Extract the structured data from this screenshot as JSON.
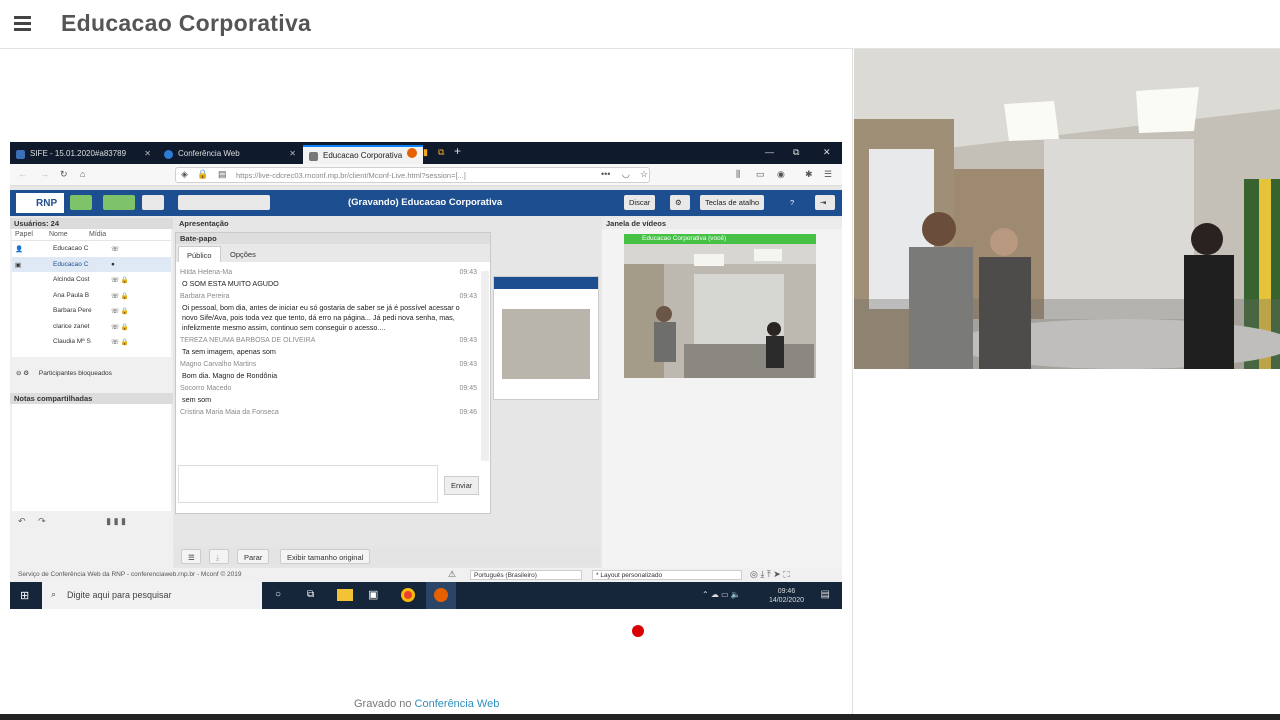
{
  "header": {
    "title": "Educacao Corporativa"
  },
  "footer": {
    "credit_prefix": "Gravado no",
    "credit_link": "Conferência Web"
  },
  "browser": {
    "tabs": [
      {
        "label": "SIFE - 15.01.2020#a83789"
      },
      {
        "label": "Conferência Web"
      },
      {
        "label": "Educacao Corporativa"
      }
    ],
    "url": "https://live-cdcrec03.rnconf.mp.br/client/Mconf-Live.html?session=[...]"
  },
  "conference": {
    "recording_title": "(Gravando) Educacao Corporativa",
    "discar_label": "Discar",
    "shortcuts_label": "Teclas de atalho",
    "users_header": "Usuários: 24",
    "col_role": "Papel",
    "col_name": "Nome",
    "col_media": "Mídia",
    "users": [
      "Educacao C",
      "Educacao C",
      "Alcinda Cost",
      "Ana Paula B",
      "Barbara Pere",
      "clarice zanet",
      "Claudia Mª S"
    ],
    "blocked_label": "Participantes bloqueados",
    "notes_header": "Notas compartilhadas",
    "presentation_header": "Apresentação",
    "chat_header": "Bate-papo",
    "chat_tab_public": "Público",
    "chat_tab_options": "Opções",
    "send_label": "Enviar",
    "messages": [
      {
        "who": "Hilda Helena-Ma",
        "time": "09:43",
        "text": "O SOM ESTA MUITO AGUDO"
      },
      {
        "who": "Barbara Pereira",
        "time": "09:43",
        "text": "Oi pessoal, bom dia, antes de iniciar eu só gostaria de saber se já é possível acessar o novo Sife/Ava, pois toda vez que tento, dá erro na página... Já pedi nova senha, mas, infelizmente mesmo assim, continuo sem conseguir o acesso...."
      },
      {
        "who": "TEREZA NEUMA BARBOSA DE OLIVEIRA",
        "time": "09:43",
        "text": "Ta sem imagem, apenas som"
      },
      {
        "who": "Magno Carvalho Martins",
        "time": "09:43",
        "text": "Bom dia. Magno de Rondônia"
      },
      {
        "who": "Socorro Macedo",
        "time": "09:45",
        "text": "sem som"
      },
      {
        "who": "Cristina Maria Maia da Fonseca",
        "time": "09:46",
        "text": ""
      }
    ],
    "video_header": "Janela de vídeos",
    "video_label": "Educacao Corporativa (você)",
    "stop_label": "Parar",
    "original_size_label": "Exibir tamanho original",
    "status_text": "Serviço de Conferência Web da RNP - conferenciaweb.rnp.br - Mconf © 2019",
    "language": "Português (Brasileiro)",
    "layout": "* Layout personalizado"
  },
  "taskbar": {
    "search_placeholder": "Digite aqui para pesquisar",
    "time": "09:46",
    "date": "14/02/2020"
  },
  "colors": {
    "conf_blue": "#1d4e8f",
    "video_green": "#45c146",
    "record_red": "#d80000",
    "link": "#2f8fbf"
  }
}
